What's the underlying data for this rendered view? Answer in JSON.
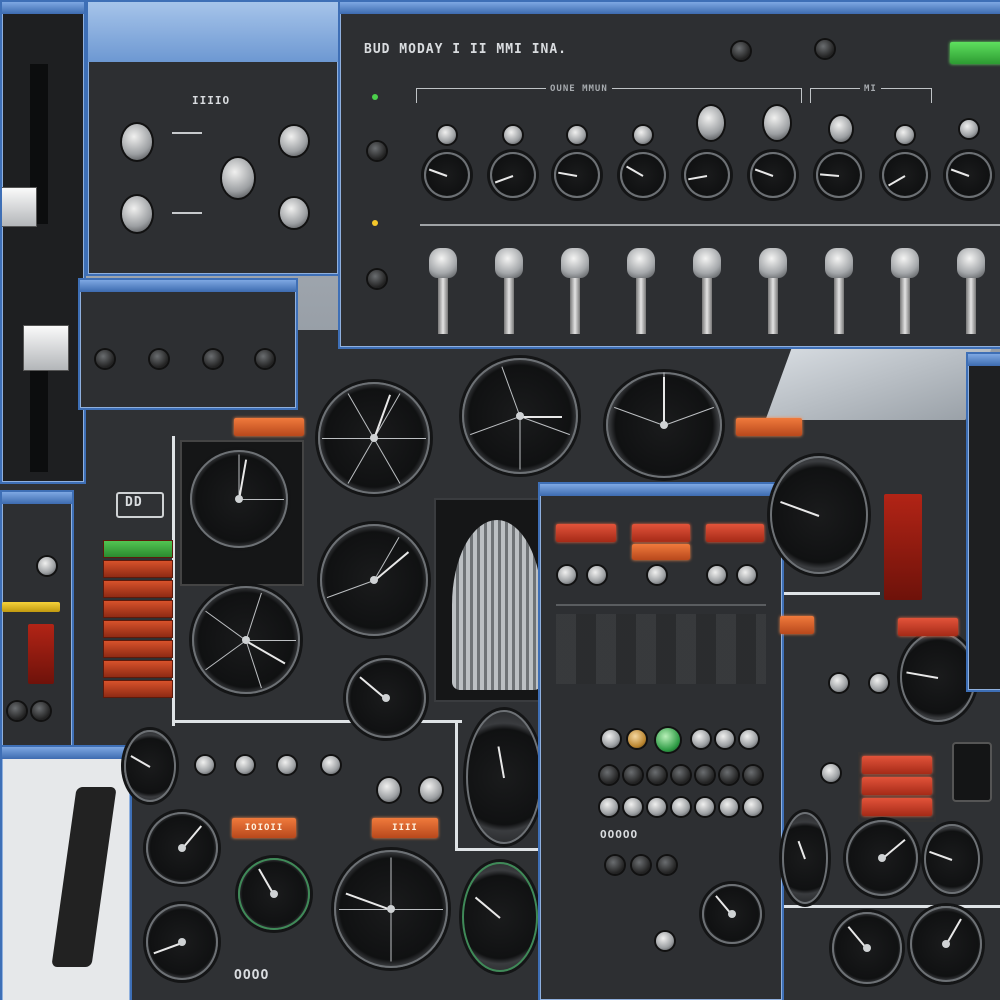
{
  "window_titles": {
    "main_switch_panel": "",
    "small_knob_panel": "",
    "radio_panel": "",
    "center_console": ""
  },
  "labels": {
    "switch_panel_title": "BUD MODAY I II MMI INA.",
    "switch_panel_sub_left": "OUNE MMUN",
    "switch_panel_sub_right": "MI",
    "knob_panel_title": "IIIIO",
    "indicator_code": "DD",
    "console_row1": "OOOOO",
    "lamp_left": "IOIOII",
    "lamp_right": "IIII",
    "bottom_codes": "OOOO"
  },
  "colors": {
    "window_border": "#3e6fb6",
    "window_title": "#5d8ccc",
    "panel": "#2d2f32",
    "lamp_red": "#c63a22",
    "lamp_orange": "#e06a30",
    "lamp_green": "#3fbf45"
  },
  "icons": {
    "knob": "knob-icon",
    "gauge": "gauge-icon",
    "lever": "lever-icon",
    "lamp": "warning-lamp-icon"
  }
}
